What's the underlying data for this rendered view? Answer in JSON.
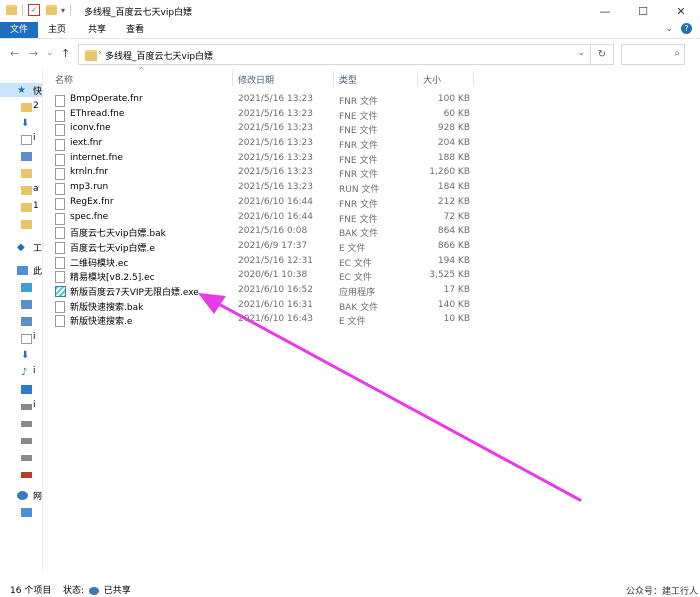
{
  "window": {
    "title": "多线程_百度云七天vip白嫖",
    "minimize": "—",
    "maximize": "☐",
    "close": "✕"
  },
  "ribbon": {
    "tabs": [
      "文件",
      "主页",
      "共享",
      "查看"
    ],
    "expand": "⌄",
    "help": "?"
  },
  "address": {
    "back": "←",
    "forward": "→",
    "recent": "⌄",
    "up": "↑",
    "path": "多线程_百度云七天vip白嫖",
    "dropdown": "⌄",
    "refresh": "↻",
    "search_icon": "⌕"
  },
  "nav": {
    "quick_access": "快",
    "section2": "工",
    "this_pc": "此",
    "network": "网",
    "row_labels": [
      "2",
      "i",
      "",
      "",
      "",
      "a",
      "1",
      "",
      "",
      "i",
      "",
      "",
      "",
      "",
      "i",
      "",
      "",
      "",
      "i",
      "",
      "",
      "",
      ""
    ]
  },
  "columns": {
    "name": "名称",
    "date": "修改日期",
    "type": "类型",
    "size": "大小"
  },
  "files": [
    {
      "name": "BmpOperate.fnr",
      "date": "2021/5/16 13:23",
      "type": "FNR 文件",
      "size": "100 KB",
      "icon": "file"
    },
    {
      "name": "EThread.fne",
      "date": "2021/5/16 13:23",
      "type": "FNE 文件",
      "size": "60 KB",
      "icon": "file"
    },
    {
      "name": "iconv.fne",
      "date": "2021/5/16 13:23",
      "type": "FNE 文件",
      "size": "928 KB",
      "icon": "file"
    },
    {
      "name": "iext.fnr",
      "date": "2021/5/16 13:23",
      "type": "FNR 文件",
      "size": "204 KB",
      "icon": "file"
    },
    {
      "name": "internet.fne",
      "date": "2021/5/16 13:23",
      "type": "FNE 文件",
      "size": "188 KB",
      "icon": "file"
    },
    {
      "name": "krnln.fnr",
      "date": "2021/5/16 13:23",
      "type": "FNR 文件",
      "size": "1,260 KB",
      "icon": "file"
    },
    {
      "name": "mp3.run",
      "date": "2021/5/16 13:23",
      "type": "RUN 文件",
      "size": "184 KB",
      "icon": "file"
    },
    {
      "name": "RegEx.fnr",
      "date": "2021/6/10 16:44",
      "type": "FNR 文件",
      "size": "212 KB",
      "icon": "file"
    },
    {
      "name": "spec.fne",
      "date": "2021/6/10 16:44",
      "type": "FNE 文件",
      "size": "72 KB",
      "icon": "file"
    },
    {
      "name": "百度云七天vip白嫖.bak",
      "date": "2021/5/16 0:08",
      "type": "BAK 文件",
      "size": "864 KB",
      "icon": "file"
    },
    {
      "name": "百度云七天vip白嫖.e",
      "date": "2021/6/9 17:37",
      "type": "E 文件",
      "size": "866 KB",
      "icon": "file"
    },
    {
      "name": "二维码模块.ec",
      "date": "2021/5/16 12:31",
      "type": "EC 文件",
      "size": "194 KB",
      "icon": "file"
    },
    {
      "name": "精易模块[v8.2.5].ec",
      "date": "2020/6/1 10:38",
      "type": "EC 文件",
      "size": "3,525 KB",
      "icon": "file"
    },
    {
      "name": "新版百度云7天VIP无限白嫖.exe",
      "date": "2021/6/10 16:52",
      "type": "应用程序",
      "size": "17 KB",
      "icon": "exe"
    },
    {
      "name": "新版快速搜索.bak",
      "date": "2021/6/10 16:31",
      "type": "BAK 文件",
      "size": "140 KB",
      "icon": "file"
    },
    {
      "name": "新版快速搜索.e",
      "date": "2021/6/10 16:43",
      "type": "E 文件",
      "size": "10 KB",
      "icon": "file"
    }
  ],
  "status": {
    "count": "16 个项目",
    "state_label": "状态:",
    "state_value": "已共享"
  },
  "watermark": "公众号：建工行人",
  "arrow_color": "#e83ae8"
}
